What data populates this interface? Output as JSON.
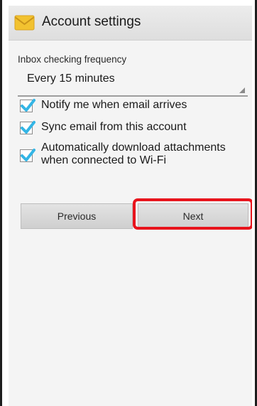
{
  "header": {
    "title": "Account settings",
    "icon": "email-app-icon"
  },
  "inbox_frequency": {
    "label": "Inbox checking frequency",
    "selected": "Every 15 minutes"
  },
  "options": [
    {
      "label": "Notify me when email arrives",
      "checked": true
    },
    {
      "label": "Sync email from this account",
      "checked": true
    },
    {
      "label_line1": "Automatically download attachments",
      "label_line2": "when connected to Wi-Fi",
      "checked": true
    }
  ],
  "buttons": {
    "previous": "Previous",
    "next": "Next"
  },
  "colors": {
    "accent": "#33b5e5",
    "highlight": "#e8141c"
  }
}
